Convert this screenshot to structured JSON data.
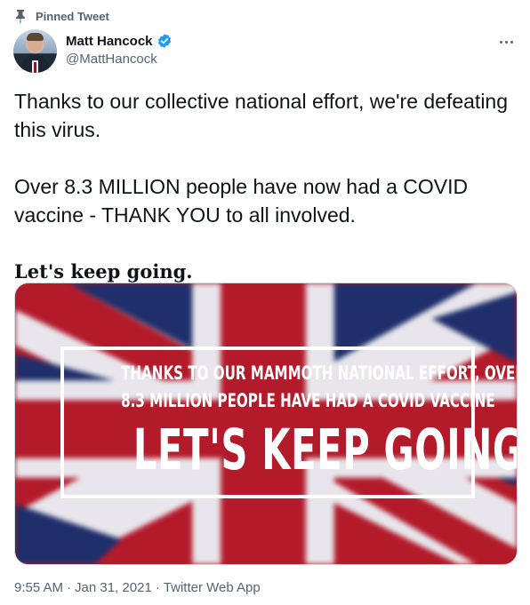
{
  "pinned": {
    "label": "Pinned Tweet",
    "icon": "pin-icon"
  },
  "author": {
    "name": "Matt Hancock",
    "handle": "@MattHancock",
    "verified_icon": "verified-badge-icon",
    "verified_color": "#1d9bf0"
  },
  "more_icon": "more-options-icon",
  "tweet": {
    "paragraph1": "Thanks to our collective national effort, we're defeating this virus.",
    "paragraph2": "Over 8.3 MILLION people have now had a COVID vaccine - THANK YOU to all involved.",
    "paragraph3": "𝐋𝐞𝐭'𝐬 𝐤𝐞𝐞𝐩 𝐠𝐨𝐢𝐧𝐠."
  },
  "media": {
    "line1": "THANKS TO OUR MAMMOTH NATIONAL EFFORT, OVER",
    "line2": "8.3 MILLION PEOPLE HAVE HAD A COVID VACCINE",
    "headline": "LET'S KEEP GOING",
    "colors": {
      "red": "#b31b2a",
      "blue": "#1f2f6b",
      "white": "#e8e6ec"
    }
  },
  "meta": {
    "time": "9:55 AM",
    "separator1": "·",
    "date": "Jan 31, 2021",
    "separator2": "·",
    "source": "Twitter Web App"
  }
}
